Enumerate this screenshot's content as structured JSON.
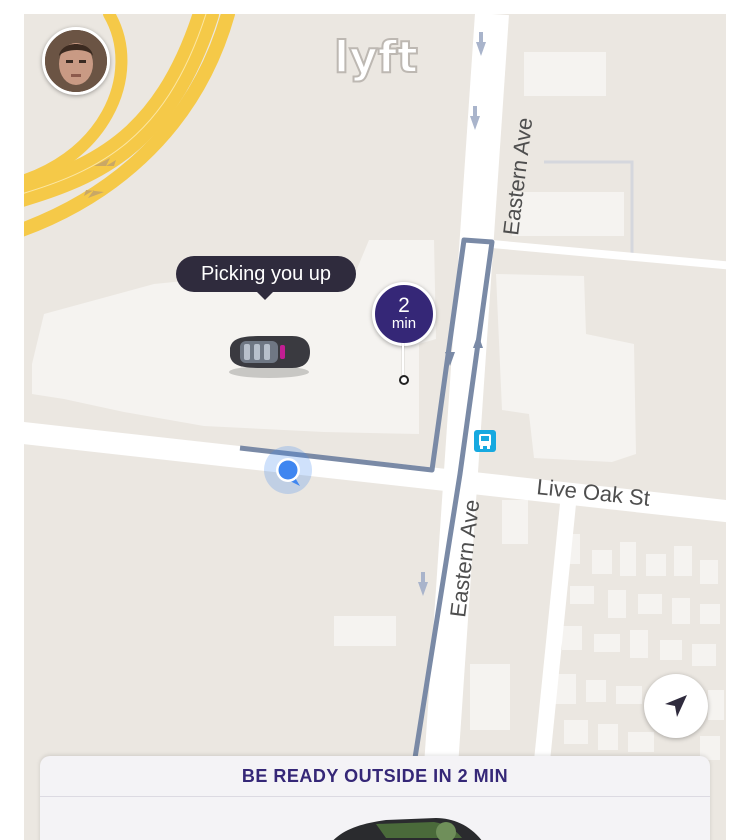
{
  "app": {
    "logo_text": "lyft"
  },
  "map": {
    "streets": [
      {
        "name": "Eastern Ave"
      },
      {
        "name": "Eastern Ave"
      },
      {
        "name": "Live Oak St"
      }
    ]
  },
  "driver": {
    "status_tooltip": "Picking you up",
    "eta_value": "2",
    "eta_unit": "min"
  },
  "bottom_card": {
    "title": "BE READY OUTSIDE IN 2 MIN"
  },
  "icons": {
    "avatar": "user-avatar",
    "car": "car-icon",
    "bus": "bus-stop-icon",
    "location": "user-location-icon",
    "locate": "navigation-arrow-icon"
  },
  "colors": {
    "accent_purple": "#352777",
    "route_line": "#7a8aa6",
    "user_dot": "#3f86f0",
    "highway": "#f5c948",
    "map_bg": "#ebe7e1"
  }
}
